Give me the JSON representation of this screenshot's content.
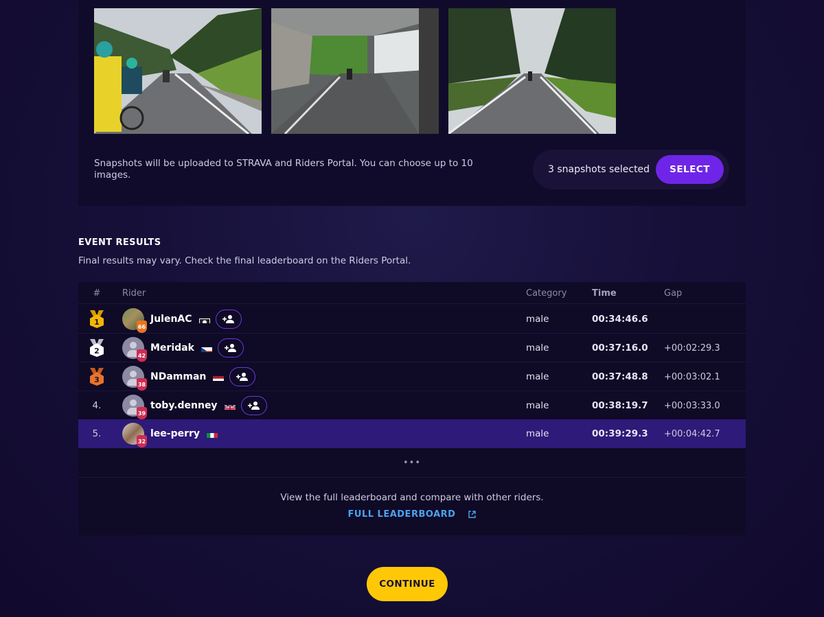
{
  "snapshots": {
    "images": [
      {
        "name": "snapshot-cyclists-road"
      },
      {
        "name": "snapshot-tunnel-road"
      },
      {
        "name": "snapshot-forest-road"
      }
    ],
    "note": "Snapshots will be uploaded to STRAVA and Riders Portal. You can choose up to 10 images.",
    "count_label": "3 snapshots selected",
    "select_label": "SELECT"
  },
  "results": {
    "title": "EVENT RESULTS",
    "subtitle": "Final results may vary. Check the final leaderboard on the Riders Portal.",
    "columns": {
      "rank": "#",
      "rider": "Rider",
      "category": "Category",
      "time": "Time",
      "gap": "Gap"
    },
    "rows": [
      {
        "rank": "1",
        "medal": "gold",
        "name": "JulenAC",
        "level": "66",
        "flag": "other",
        "category": "male",
        "time": "00:34:46.6",
        "gap": "",
        "follow": true
      },
      {
        "rank": "2",
        "medal": "silver",
        "name": "Meridak",
        "level": "42",
        "flag": "czech",
        "category": "male",
        "time": "00:37:16.0",
        "gap": "+00:02:29.3",
        "follow": true
      },
      {
        "rank": "3",
        "medal": "bronze",
        "name": "NDamman",
        "level": "38",
        "flag": "netherlands",
        "category": "male",
        "time": "00:37:48.8",
        "gap": "+00:03:02.1",
        "follow": true
      },
      {
        "rank": "4.",
        "medal": "",
        "name": "toby.denney",
        "level": "39",
        "flag": "uk",
        "category": "male",
        "time": "00:38:19.7",
        "gap": "+00:03:33.0",
        "follow": true
      },
      {
        "rank": "5.",
        "medal": "",
        "name": "lee-perry",
        "level": "32",
        "flag": "italy",
        "category": "male",
        "time": "00:39:29.3",
        "gap": "+00:04:42.7",
        "follow": false,
        "highlighted": true
      }
    ],
    "ellipsis": "•••",
    "footer_text": "View the full leaderboard and compare with other riders.",
    "footer_link": "FULL LEADERBOARD"
  },
  "continue_label": "CONTINUE",
  "colors": {
    "accent_purple": "#6f25e8",
    "continue_yellow": "#ffc807",
    "link_blue": "#4aa3f0",
    "highlight_row": "#2e1a78"
  }
}
